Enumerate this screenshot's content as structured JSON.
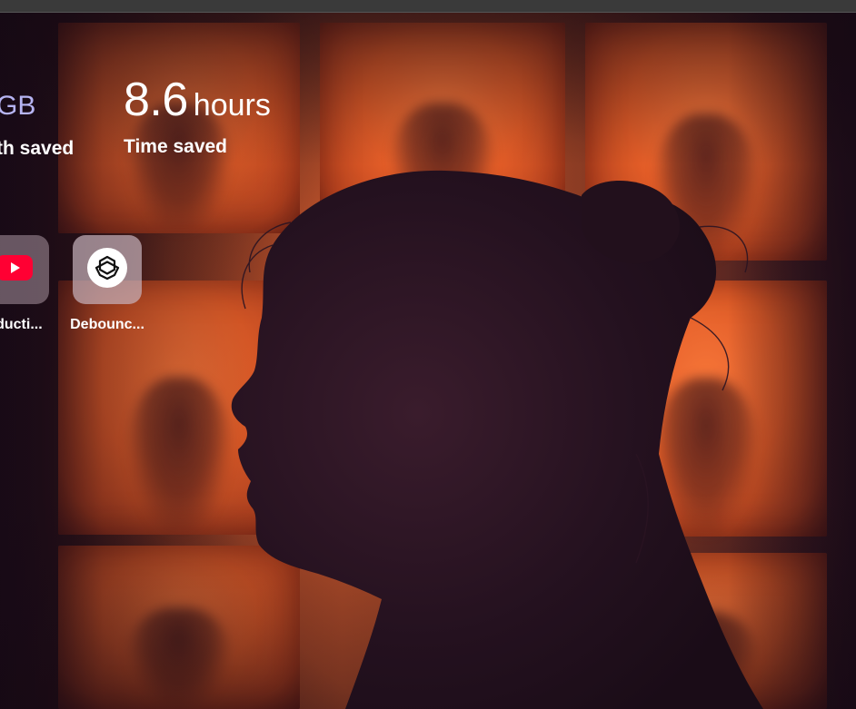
{
  "stats": {
    "storage": {
      "value_unit": "GB",
      "label": "th saved"
    },
    "time": {
      "value": "8.6",
      "unit": "hours",
      "label": "Time saved"
    }
  },
  "apps": [
    {
      "label": "oducti...",
      "icon": "youtube-icon",
      "color": "#ff0033"
    },
    {
      "label": "Debounc...",
      "icon": "openai-icon",
      "color": "#ffffff"
    }
  ],
  "colors": {
    "accent": "#b6b4f2",
    "tile_bg": "#9a8e96",
    "backdrop_orange": "#e85f28"
  }
}
